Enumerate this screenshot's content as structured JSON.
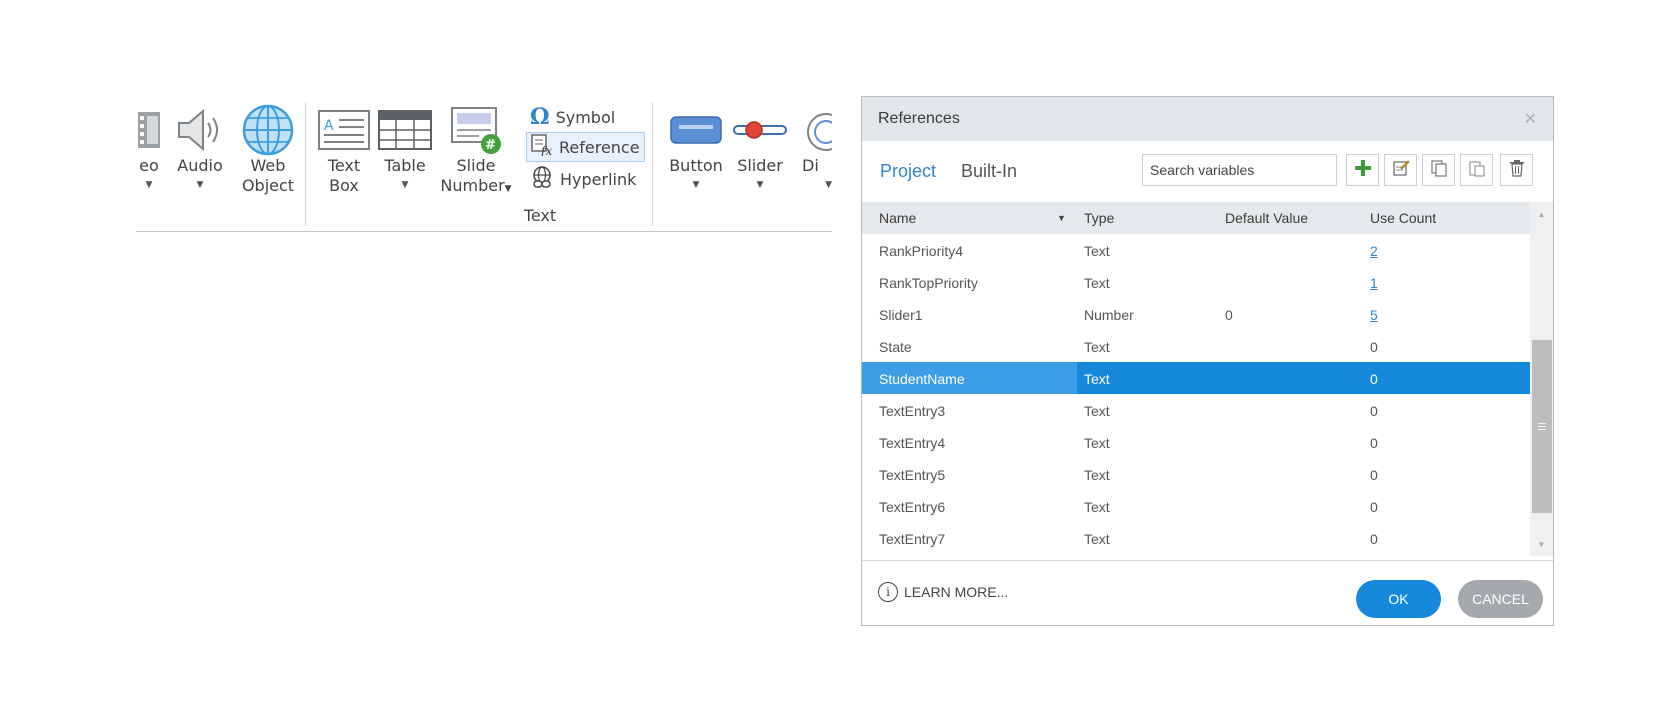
{
  "ribbon": {
    "items": [
      {
        "label": "eo",
        "label2": "",
        "caret": true
      },
      {
        "label": "Audio",
        "label2": "",
        "caret": true
      },
      {
        "label": "Web",
        "label2": "Object",
        "caret": false
      },
      {
        "label": "Text",
        "label2": "Box",
        "caret": false
      },
      {
        "label": "Table",
        "label2": "",
        "caret": true
      },
      {
        "label": "Slide",
        "label2": "Number",
        "caret": false
      },
      {
        "label": "Button",
        "label2": "",
        "caret": true
      },
      {
        "label": "Slider",
        "label2": "",
        "caret": true
      },
      {
        "label": "Di",
        "label2": "",
        "caret": true
      }
    ],
    "small_buttons": {
      "symbol": "Symbol",
      "reference": "Reference",
      "hyperlink": "Hyperlink"
    },
    "group_text": "Text"
  },
  "dialog": {
    "title": "References",
    "tabs": {
      "project": "Project",
      "builtin": "Built-In"
    },
    "search_placeholder": "Search variables",
    "columns": {
      "name": "Name",
      "type": "Type",
      "default": "Default Value",
      "use": "Use Count"
    },
    "rows": [
      {
        "name": "RankPriority4",
        "type": "Text",
        "default": "",
        "use": "2",
        "link": true
      },
      {
        "name": "RankTopPriority",
        "type": "Text",
        "default": "",
        "use": "1",
        "link": true
      },
      {
        "name": "Slider1",
        "type": "Number",
        "default": "0",
        "use": "5",
        "link": true
      },
      {
        "name": "State",
        "type": "Text",
        "default": "",
        "use": "0",
        "link": false
      },
      {
        "name": "StudentName",
        "type": "Text",
        "default": "",
        "use": "0",
        "link": false,
        "selected": true
      },
      {
        "name": "TextEntry3",
        "type": "Text",
        "default": "",
        "use": "0",
        "link": false
      },
      {
        "name": "TextEntry4",
        "type": "Text",
        "default": "",
        "use": "0",
        "link": false
      },
      {
        "name": "TextEntry5",
        "type": "Text",
        "default": "",
        "use": "0",
        "link": false
      },
      {
        "name": "TextEntry6",
        "type": "Text",
        "default": "",
        "use": "0",
        "link": false
      },
      {
        "name": "TextEntry7",
        "type": "Text",
        "default": "",
        "use": "0",
        "link": false
      }
    ],
    "learn_more": "LEARN MORE...",
    "ok": "OK",
    "cancel": "CANCEL"
  },
  "colors": {
    "accent": "#1689dd",
    "selected_name_cell": "#3d9ee6",
    "header_bg": "#e2e6ea"
  }
}
